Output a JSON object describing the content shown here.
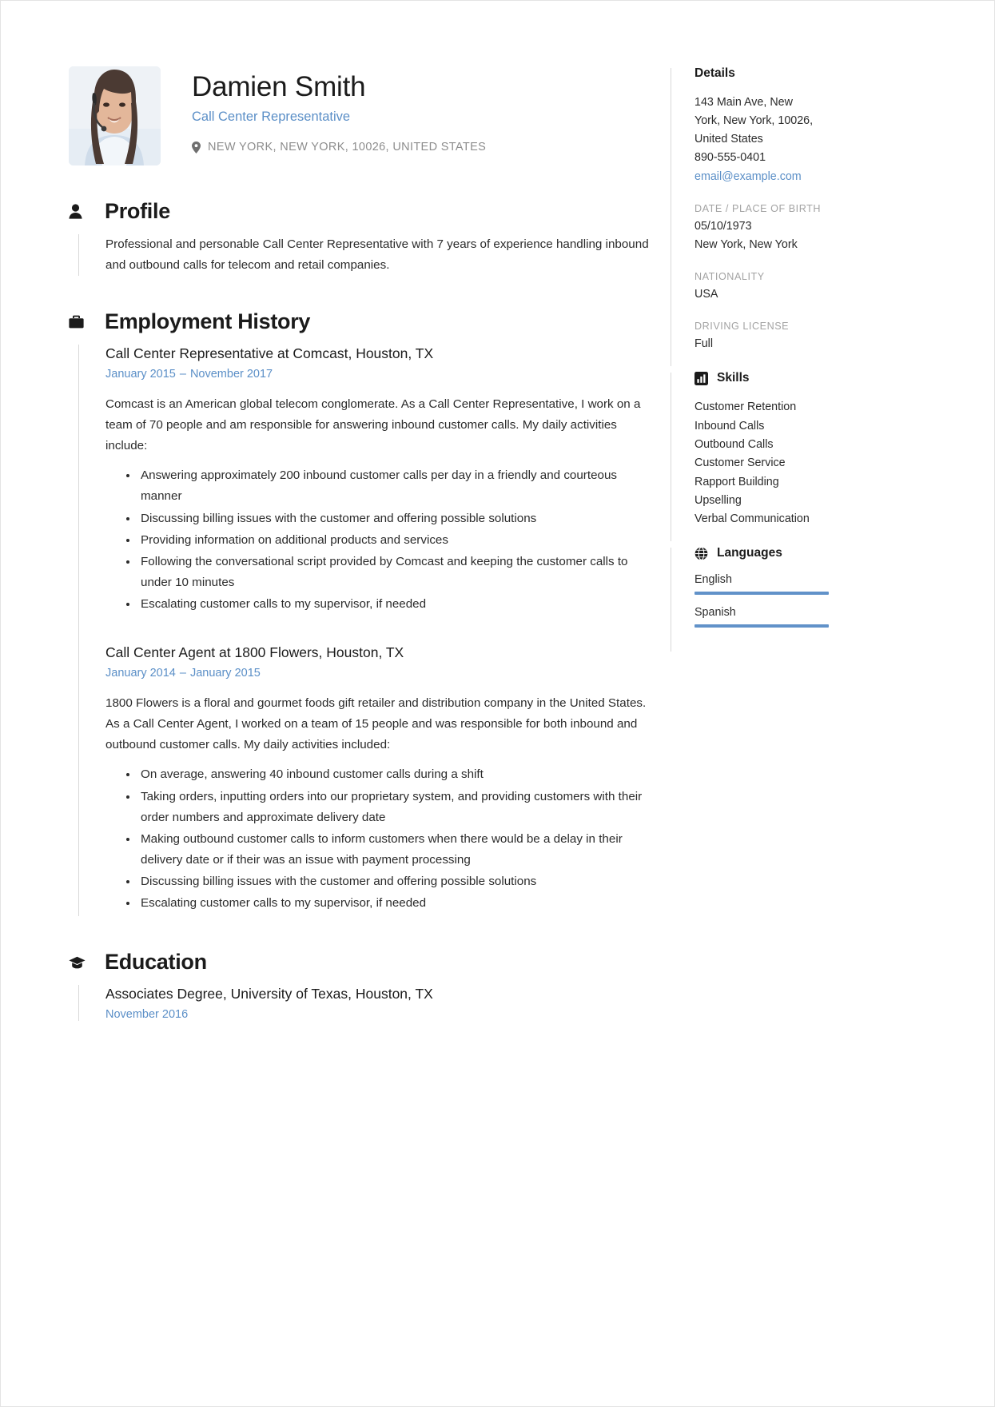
{
  "theme": {
    "accent": "#5b8fc7",
    "text": "#2b2b2b",
    "muted": "#a3a3a3",
    "rule": "#d8d8d8"
  },
  "header": {
    "photo_alt": "profile-photo",
    "name": "Damien Smith",
    "job_title": "Call Center Representative",
    "location": "NEW YORK, NEW YORK, 10026, UNITED STATES",
    "location_icon": "map-pin-icon"
  },
  "sections": {
    "profile": {
      "icon": "person-icon",
      "title": "Profile",
      "text": "Professional and personable Call Center Representative with 7 years of experience handling inbound and outbound calls for telecom and retail companies."
    },
    "employment": {
      "icon": "briefcase-icon",
      "title": "Employment History",
      "jobs": [
        {
          "name": "Call Center Representative at Comcast, Houston, TX",
          "start": "January 2015",
          "dash": "–",
          "end": "November 2017",
          "description": "Comcast is an American global telecom conglomerate. As a Call Center Representative, I work on a team of 70 people and am responsible for answering inbound customer calls. My daily activities include:",
          "bullets": [
            "Answering approximately 200 inbound customer calls per day in a friendly and courteous manner",
            "Discussing billing issues with the customer and offering possible solutions",
            "Providing information on additional products and services",
            "Following the conversational script provided by Comcast and keeping the customer calls to under 10 minutes",
            "Escalating customer calls to my supervisor, if needed"
          ]
        },
        {
          "name": "Call Center Agent at 1800 Flowers, Houston, TX",
          "start": "January 2014",
          "dash": "–",
          "end": "January 2015",
          "description": "1800 Flowers is a floral and gourmet foods gift retailer and distribution company in the United States. As a Call Center Agent, I worked on a team of 15 people and was responsible for both inbound and outbound customer calls. My daily activities included:",
          "bullets": [
            "On average, answering 40 inbound customer calls during a shift",
            "Taking orders, inputting orders into our proprietary system, and providing customers with their order numbers and approximate delivery date",
            "Making outbound customer calls to inform customers when there would be a delay in their delivery date or if their was an issue with payment processing",
            "Discussing billing issues with the customer and offering possible solutions",
            "Escalating customer calls to my supervisor, if needed"
          ]
        }
      ]
    },
    "education": {
      "icon": "graduation-cap-icon",
      "title": "Education",
      "entries": [
        {
          "name": "Associates Degree, University of Texas, Houston, TX",
          "date": "November 2016"
        }
      ]
    }
  },
  "sidebar": {
    "details": {
      "title": "Details",
      "address_line1": "143 Main Ave, New",
      "address_line2": "York, New York, 10026,",
      "address_line3": "United States",
      "phone": "890-555-0401",
      "email": "email@example.com",
      "dob_label": "DATE / PLACE OF BIRTH",
      "dob_date": "05/10/1973",
      "dob_place": "New York, New York",
      "nationality_label": "NATIONALITY",
      "nationality": "USA",
      "license_label": "DRIVING LICENSE",
      "license": "Full"
    },
    "skills": {
      "icon": "bar-chart-icon",
      "title": "Skills",
      "items": [
        "Customer Retention",
        "Inbound Calls",
        "Outbound Calls",
        "Customer Service",
        "Rapport Building",
        "Upselling",
        "Verbal Communication"
      ]
    },
    "languages": {
      "icon": "globe-icon",
      "title": "Languages",
      "items": [
        {
          "name": "English",
          "level": 100
        },
        {
          "name": "Spanish",
          "level": 100
        }
      ]
    }
  }
}
